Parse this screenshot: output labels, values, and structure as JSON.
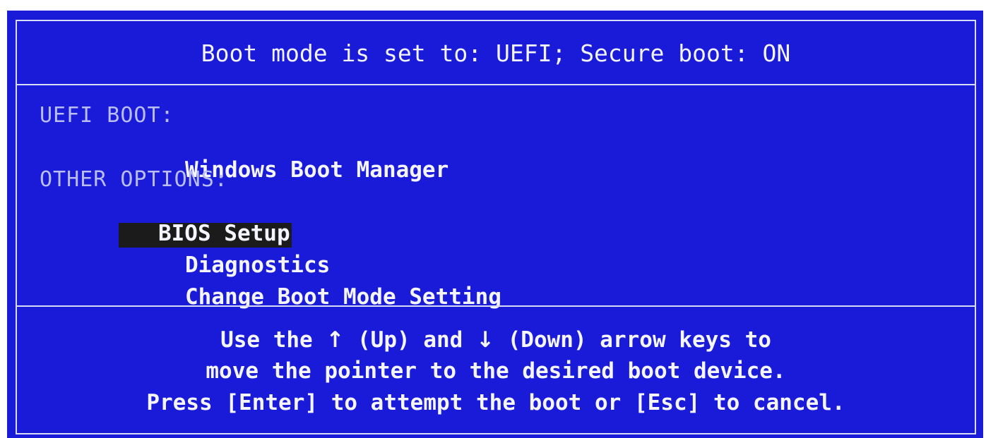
{
  "colors": {
    "background": "#1a1ad9",
    "border": "#d8dcf7",
    "text": "#ffffff",
    "label_text": "#b9bdf0",
    "selection_bg": "#1b1b1b"
  },
  "header": {
    "title": "Boot mode is set to: UEFI; Secure boot: ON"
  },
  "menu": {
    "uefi_label": "UEFI BOOT:",
    "uefi_items": [
      {
        "label": "Windows Boot Manager"
      }
    ],
    "other_label": "OTHER OPTIONS:",
    "other_items": [
      {
        "label": "BIOS Setup",
        "selected": true
      },
      {
        "label": "Diagnostics",
        "selected": false
      },
      {
        "label": "Change Boot Mode Setting",
        "selected": false
      }
    ]
  },
  "footer": {
    "line1_a": "Use the ",
    "up_arrow": "↑",
    "line1_b": " (Up) and ",
    "down_arrow": "↓",
    "line1_c": " (Down) arrow keys to",
    "line2": "move the pointer to the desired boot device.",
    "line3": "Press [Enter] to attempt the boot or [Esc] to cancel."
  }
}
